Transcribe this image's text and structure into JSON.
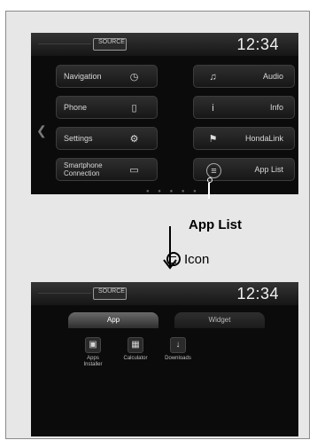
{
  "top_screen": {
    "source_label": "SOURCE",
    "clock": "12:34",
    "left_column": [
      {
        "label": "Navigation",
        "icon": "compass-icon",
        "glyph": "◷"
      },
      {
        "label": "Phone",
        "icon": "phone-icon",
        "glyph": "▯"
      },
      {
        "label": "Settings",
        "icon": "gear-icon",
        "glyph": "⚙"
      },
      {
        "label": "Smartphone\nConnection",
        "icon": "smartphone-icon",
        "glyph": "▭"
      }
    ],
    "right_column": [
      {
        "label": "Audio",
        "icon": "music-note-icon",
        "glyph": "♫"
      },
      {
        "label": "Info",
        "icon": "info-icon",
        "glyph": "i"
      },
      {
        "label": "HondaLink",
        "icon": "hondalink-icon",
        "glyph": "⚑"
      },
      {
        "label": "App List",
        "icon": "app-list-icon",
        "glyph": "≡"
      }
    ]
  },
  "callout": {
    "title": "App List",
    "icon_text": "Icon"
  },
  "bottom_screen": {
    "source_label": "SOURCE",
    "clock": "12:34",
    "tabs": [
      "App",
      "Widget"
    ],
    "apps": [
      {
        "name": "Apps Installer",
        "icon": "apps-installer-icon",
        "glyph": "▣"
      },
      {
        "name": "Calculator",
        "icon": "calculator-icon",
        "glyph": "▦"
      },
      {
        "name": "Downloads",
        "icon": "downloads-icon",
        "glyph": "↓"
      }
    ]
  }
}
